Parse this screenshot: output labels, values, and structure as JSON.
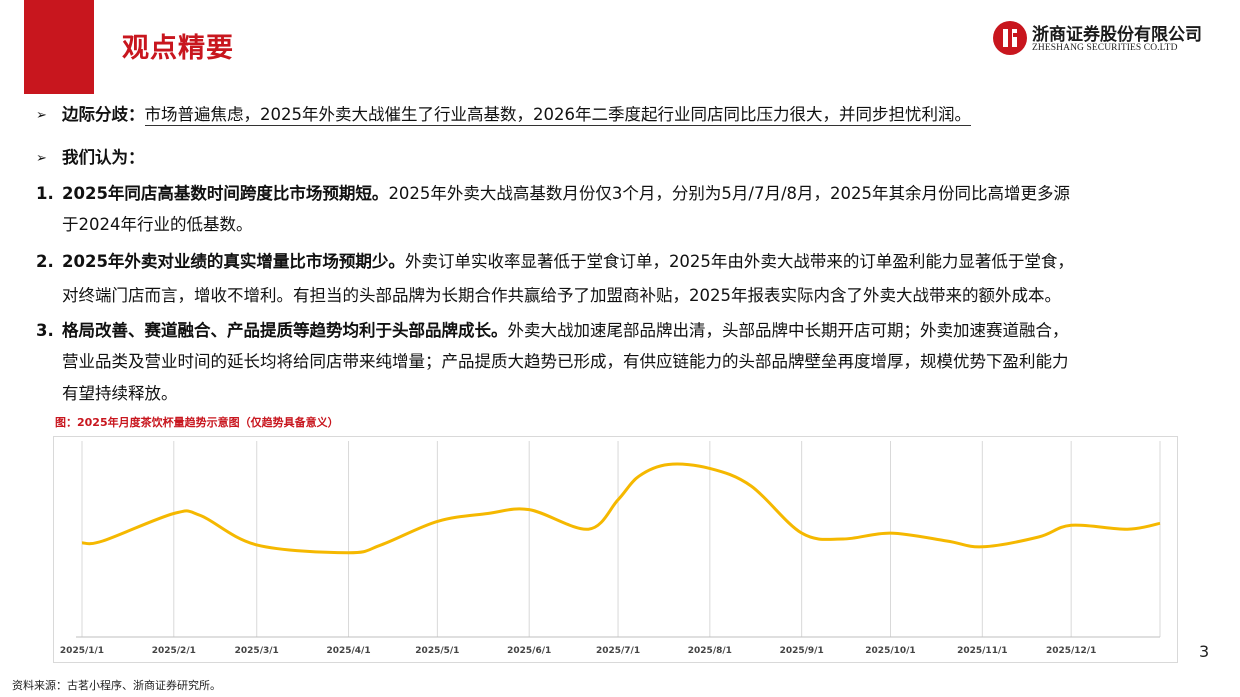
{
  "header": {
    "title": "观点精要",
    "logo_cn": "浙商证券股份有限公司",
    "logo_en": "ZHESHANG SECURITIES CO.LTD",
    "accent_color": "#c8161e"
  },
  "bullets": [
    {
      "icon": "arrow-bullet-icon",
      "label": "边际分歧",
      "colon": "：",
      "text": "市场普遍焦虑，2025年外卖大战催生了行业高基数，2026年二季度起行业同店同比压力很大，并同步担忧利润。"
    },
    {
      "icon": "arrow-bullet-icon",
      "label": "我们认为：",
      "text": ""
    }
  ],
  "points": [
    {
      "num": "1.",
      "bold": "2025年同店高基数时间跨度比市场预期短。",
      "line1": "2025年外卖大战高基数月份仅3个月，分别为5月/7月/8月，2025年其余月份同比高增更多源",
      "line2": "于2024年行业的低基数。"
    },
    {
      "num": "2.",
      "bold": "2025年外卖对业绩的真实增量比市场预期少。",
      "line1": "外卖订单实收率显著低于堂食订单，2025年由外卖大战带来的订单盈利能力显著低于堂食，",
      "line2": "对终端门店而言，增收不增利。有担当的头部品牌为长期合作共赢给予了加盟商补贴，2025年报表实际内含了外卖大战带来的额外成本。"
    },
    {
      "num": "3.",
      "bold": "格局改善、赛道融合、产品提质等趋势均利于头部品牌成长。",
      "line1": "外卖大战加速尾部品牌出清，头部品牌中长期开店可期；外卖加速赛道融合，",
      "line2": "营业品类及营业时间的延长均将给同店带来纯增量；产品提质大趋势已形成，有供应链能力的头部品牌壁垒再度增厚，规模优势下盈利能力",
      "line3": "有望持续释放。"
    }
  ],
  "chart_title": "图：2025年月度茶饮杯量趋势示意图（仅趋势具备意义）",
  "chart_data": {
    "type": "line",
    "title": "图：2025年月度茶饮杯量趋势示意图（仅趋势具备意义）",
    "xlabel": "",
    "ylabel": "",
    "y_ticks_shown": false,
    "grid": "vertical",
    "line_color": "#f5b800",
    "x_ticks": [
      "2025/1/1",
      "2025/2/1",
      "2025/3/1",
      "2025/4/1",
      "2025/5/1",
      "2025/6/1",
      "2025/7/1",
      "2025/8/1",
      "2025/9/1",
      "2025/10/1",
      "2025/11/1",
      "2025/12/1"
    ],
    "x": [
      "2025/1/1",
      "2025/1/8",
      "2025/2/1",
      "2025/2/10",
      "2025/3/1",
      "2025/4/1",
      "2025/4/12",
      "2025/5/1",
      "2025/5/18",
      "2025/6/1",
      "2025/6/21",
      "2025/7/1",
      "2025/7/8",
      "2025/7/18",
      "2025/8/1",
      "2025/8/15",
      "2025/9/1",
      "2025/9/15",
      "2025/10/1",
      "2025/10/20",
      "2025/11/1",
      "2025/11/20",
      "2025/12/1",
      "2025/12/20",
      "2025/12/31"
    ],
    "values": [
      48,
      49,
      63,
      62,
      47,
      43,
      47,
      59,
      63,
      65,
      55,
      70,
      82,
      88,
      86,
      77,
      53,
      50,
      53,
      49,
      46,
      51,
      57,
      55,
      58
    ]
  },
  "page_number": "3",
  "source": "资料来源：古茗小程序、浙商证券研究所。"
}
